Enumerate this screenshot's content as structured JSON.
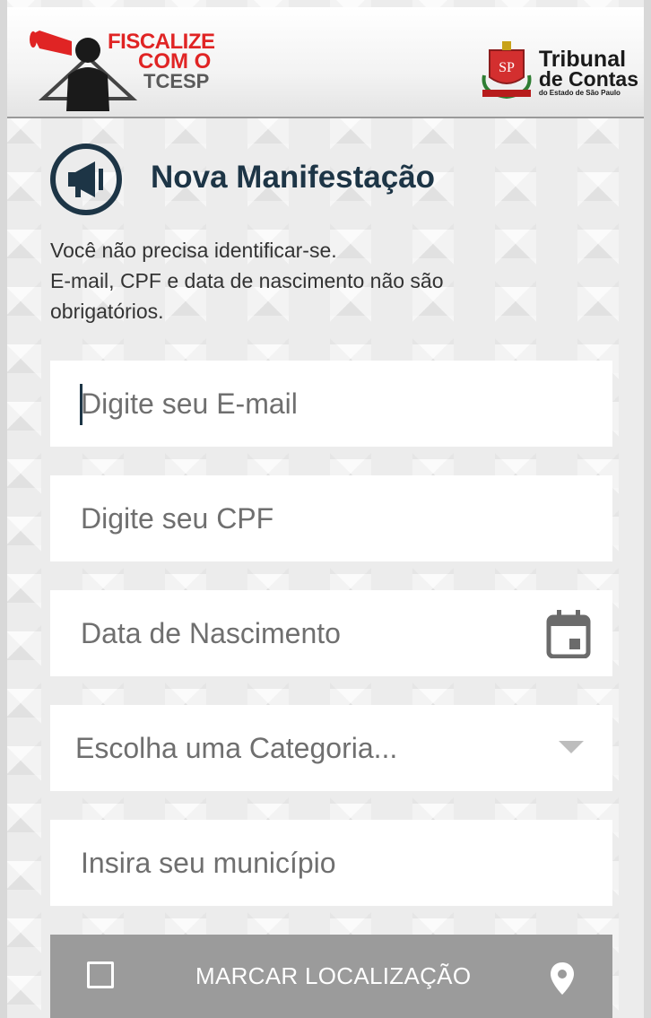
{
  "header": {
    "brand_line1": "FISCALIZE",
    "brand_line2": "COM O",
    "brand_line3": "TCESP",
    "org_line1": "Tribunal",
    "org_line2": "de Contas",
    "org_line3": "do Estado de São Paulo",
    "seal_text": "SP"
  },
  "page": {
    "title": "Nova Manifestação",
    "title_icon": "megaphone-icon",
    "info_line1": "Você não precisa identificar-se.",
    "info_line2": "E-mail, CPF e data de nascimento não são",
    "info_line3": "obrigatórios."
  },
  "form": {
    "email_placeholder": "Digite seu E-mail",
    "cpf_placeholder": "Digite seu CPF",
    "birth_placeholder": "Data de Nascimento",
    "birth_icon": "calendar-icon",
    "category_label": "Escolha uma Categoria...",
    "category_icon": "dropdown-triangle-icon",
    "city_placeholder": "Insira seu município"
  },
  "location": {
    "label": "MARCAR LOCALIZAÇÃO",
    "checked": false,
    "icon": "location-pin-icon"
  },
  "colors": {
    "brand_red": "#e02424",
    "title_navy": "#1d3546",
    "button_gray": "#9b9b9b"
  }
}
